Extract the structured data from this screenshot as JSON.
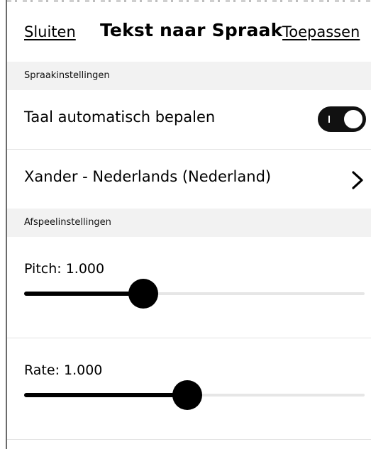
{
  "header": {
    "close_label": "Sluiten",
    "title": "Tekst naar Spraak",
    "apply_label": "Toepassen"
  },
  "speech_settings": {
    "section_label": "Spraakinstellingen",
    "auto_language": {
      "label": "Taal automatisch bepalen",
      "enabled": true
    },
    "voice": {
      "label": "Xander - Nederlands (Nederland)",
      "icon": "chevron-right-icon"
    }
  },
  "playback_settings": {
    "section_label": "Afspeelinstellingen",
    "pitch": {
      "label": "Pitch: 1.000",
      "level": 0.35
    },
    "rate": {
      "label": "Rate: 1.000",
      "level": 0.48
    }
  },
  "colors": {
    "accent": "#000000",
    "section_bg": "#f2f2f2",
    "track_bg": "#e6e6e6"
  }
}
